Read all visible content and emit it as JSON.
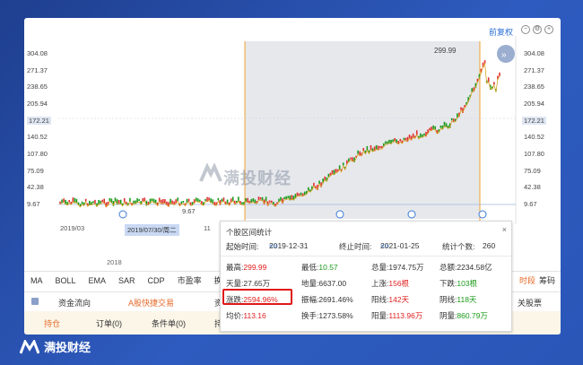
{
  "toolbar": {
    "restore_label": "前复权",
    "icons": [
      "minus-icon",
      "gear-icon",
      "plus-icon"
    ]
  },
  "price_axis": [
    "304.08",
    "271.37",
    "238.65",
    "205.94",
    "172.21",
    "140.52",
    "107.80",
    "75.09",
    "42.38",
    "9.67"
  ],
  "chart_labels": {
    "high_marker": "299.99",
    "low_marker": "9.67",
    "watermark": "满投财经"
  },
  "date_strip": {
    "left_date": "2019/03",
    "cursor_date": "2019/07/30/周二",
    "cursor_extra": "11",
    "year": "2018"
  },
  "indicator_tabs": [
    "MA",
    "BOLL",
    "EMA",
    "SAR",
    "CDP",
    "市盈率",
    "换手"
  ],
  "indicator_tabs_right": [
    "时段",
    "筹码"
  ],
  "bottom_tabs": {
    "fund_flow": "资金流向",
    "quick_trade": "A股快捷交易",
    "partial": "资",
    "related": "关股票"
  },
  "bottom_tabs2": {
    "position": "持仓",
    "orders": "订单(0)",
    "conditional": "条件单(0)",
    "partial": "持"
  },
  "stats": {
    "title": "个股区间统计",
    "start_label": "起始时间:",
    "start_value": "2019-12-31",
    "end_label": "终止时间:",
    "end_value": "2021-01-25",
    "count_label": "统计个数:",
    "count_value": "260",
    "high_label": "最高:",
    "high_value": "299.99",
    "low_label": "最低:",
    "low_value": "10.57",
    "total_vol_label": "总量:",
    "total_vol_value": "1974.75万",
    "total_amt_label": "总额:",
    "total_amt_value": "2234.58亿",
    "sky_label": "天量:",
    "sky_value": "27.65万",
    "ground_label": "地量:",
    "ground_value": "6637.00",
    "up_label": "上涨:",
    "up_value": "156根",
    "down_label": "下跌:",
    "down_value": "103根",
    "change_label": "涨跌:",
    "change_value": "2594.96%",
    "amplitude_label": "振幅:",
    "amplitude_value": "2691.46%",
    "yang_label": "阳线:",
    "yang_value": "142天",
    "yin_label": "阴线:",
    "yin_value": "118天",
    "avg_label": "均价:",
    "avg_value": "113.16",
    "turnover_label": "换手:",
    "turnover_value": "1273.58%",
    "yang_vol_label": "阳量:",
    "yang_vol_value": "1113.96万",
    "yin_vol_label": "阴量:",
    "yin_vol_value": "860.79万"
  },
  "brand": "满投财经"
}
